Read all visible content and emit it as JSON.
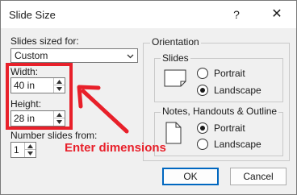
{
  "dialog": {
    "title": "Slide Size",
    "help_label": "?",
    "close_label": "✕"
  },
  "slides_sized_for": {
    "label": "Slides sized for:",
    "value": "Custom"
  },
  "width": {
    "label": "Width:",
    "value": "40 in"
  },
  "height": {
    "label": "Height:",
    "value": "28 in"
  },
  "number_slides_from": {
    "label": "Number slides from:",
    "value": "1"
  },
  "orientation": {
    "title": "Orientation",
    "slides": {
      "title": "Slides",
      "options": [
        {
          "label": "Portrait",
          "selected": false
        },
        {
          "label": "Landscape",
          "selected": true
        }
      ]
    },
    "notes": {
      "title": "Notes, Handouts & Outline",
      "options": [
        {
          "label": "Portrait",
          "selected": true
        },
        {
          "label": "Landscape",
          "selected": false
        }
      ]
    }
  },
  "buttons": {
    "ok": "OK",
    "cancel": "Cancel"
  },
  "annotation": {
    "text": "Enter dimensions",
    "color": "#e8202a"
  }
}
